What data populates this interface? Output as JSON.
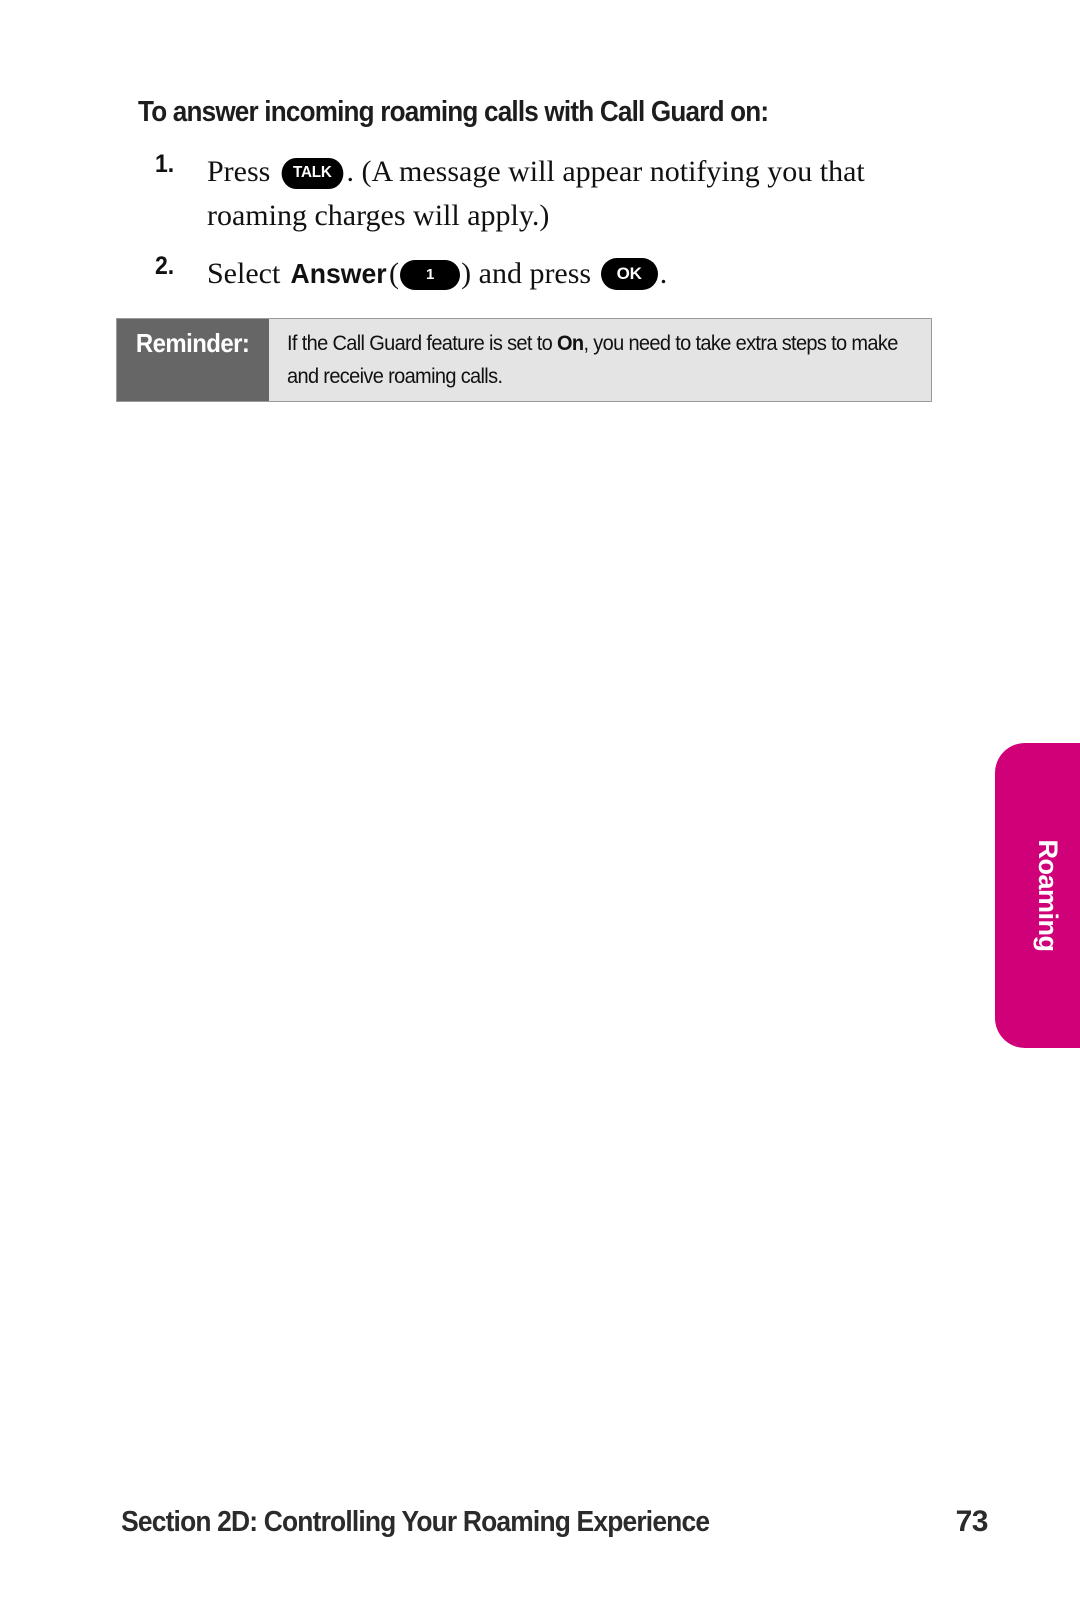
{
  "page": {
    "heading": "To answer incoming roaming calls with Call Guard on:",
    "number": "73"
  },
  "steps": [
    {
      "number": "1.",
      "text_before_key": "Press",
      "key_label": "TALK",
      "text_after_key": ". (A message will appear notifying you that roaming charges will apply.)"
    },
    {
      "number": "2.",
      "text_before": "Select",
      "bold_word": "Answer",
      "paren_open": "(",
      "key_one_label": "1",
      "paren_close": ")",
      "text_middle": "and press",
      "key_ok_label": "OK",
      "text_end": "."
    }
  ],
  "reminder": {
    "label": "Reminder:",
    "text_part1": "If the Call Guard feature is set to ",
    "text_bold": "On",
    "text_part2": ", you need to take extra steps to make and receive roaming calls."
  },
  "side_tab": {
    "label": "Roaming",
    "color": "#cf0078"
  },
  "footer": {
    "title": "Section 2D: Controlling Your Roaming Experience",
    "page_number": "73"
  },
  "colors": {
    "reminder_label_bg": "#666666",
    "reminder_body_bg": "#e4e4e4",
    "key_bg": "#000000",
    "accent_pink": "#cf0078"
  }
}
